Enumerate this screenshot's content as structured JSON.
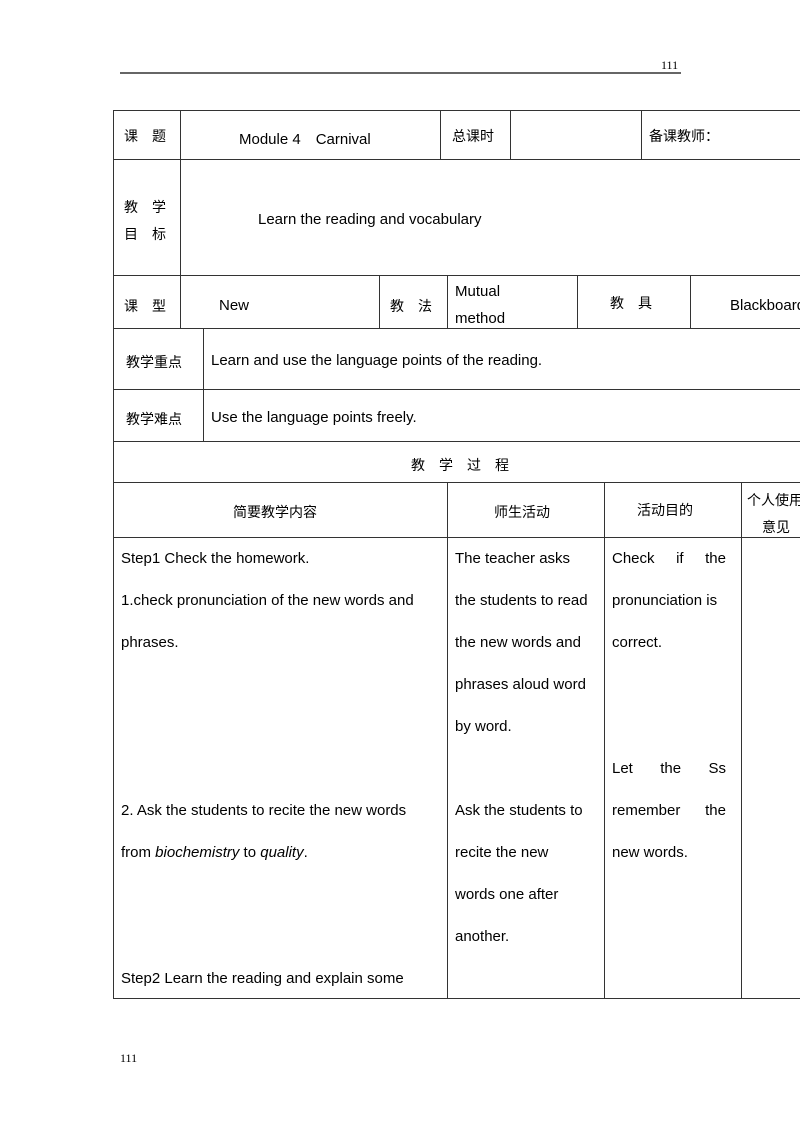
{
  "header": {
    "page_num": "111"
  },
  "footer": {
    "page_num": "111"
  },
  "info": {
    "topic_label": "课　题",
    "topic": "Module 4　Carnival",
    "hours_label": "总课时",
    "hours": "",
    "teacher_label": "备课教师：",
    "goal_label_1": "教　学",
    "goal_label_2": "目　标",
    "goal": "Learn the reading and vocabulary",
    "type_label": "课　型",
    "type": "New",
    "method_label": "教　法",
    "method_1": "Mutual",
    "method_2": "method",
    "tools_label": "教　具",
    "tools": "Blackboard",
    "key_label": "教学重点",
    "key": "Learn and use the language points of the reading.",
    "diff_label": "教学难点",
    "diff": "Use the language points freely."
  },
  "process": {
    "title": "教　学　过　程",
    "headers": [
      "简要教学内容",
      "师生活动",
      "活动目的",
      "个人使用",
      "意见"
    ],
    "col1": [
      "Step1 Check the homework.",
      "1.check pronunciation of the new words and",
      "phrases.",
      "",
      "",
      "",
      "2. Ask the students to recite the new words",
      "",
      "",
      "",
      "Step2 Learn the reading and explain some"
    ],
    "col1_line8": {
      "a": "from ",
      "b": "biochemistry",
      "c": " to ",
      "d": "quality",
      "e": "."
    },
    "col2": [
      "The teacher asks",
      "the students to read",
      "the new words and",
      "phrases aloud word",
      "by word.",
      "",
      "Ask the students to",
      "recite the new",
      "words one after",
      "another."
    ],
    "col3": [
      "Check if the",
      "pronunciation is",
      "correct.",
      "",
      "",
      "Let the Ss",
      "remember the",
      "new words."
    ]
  }
}
